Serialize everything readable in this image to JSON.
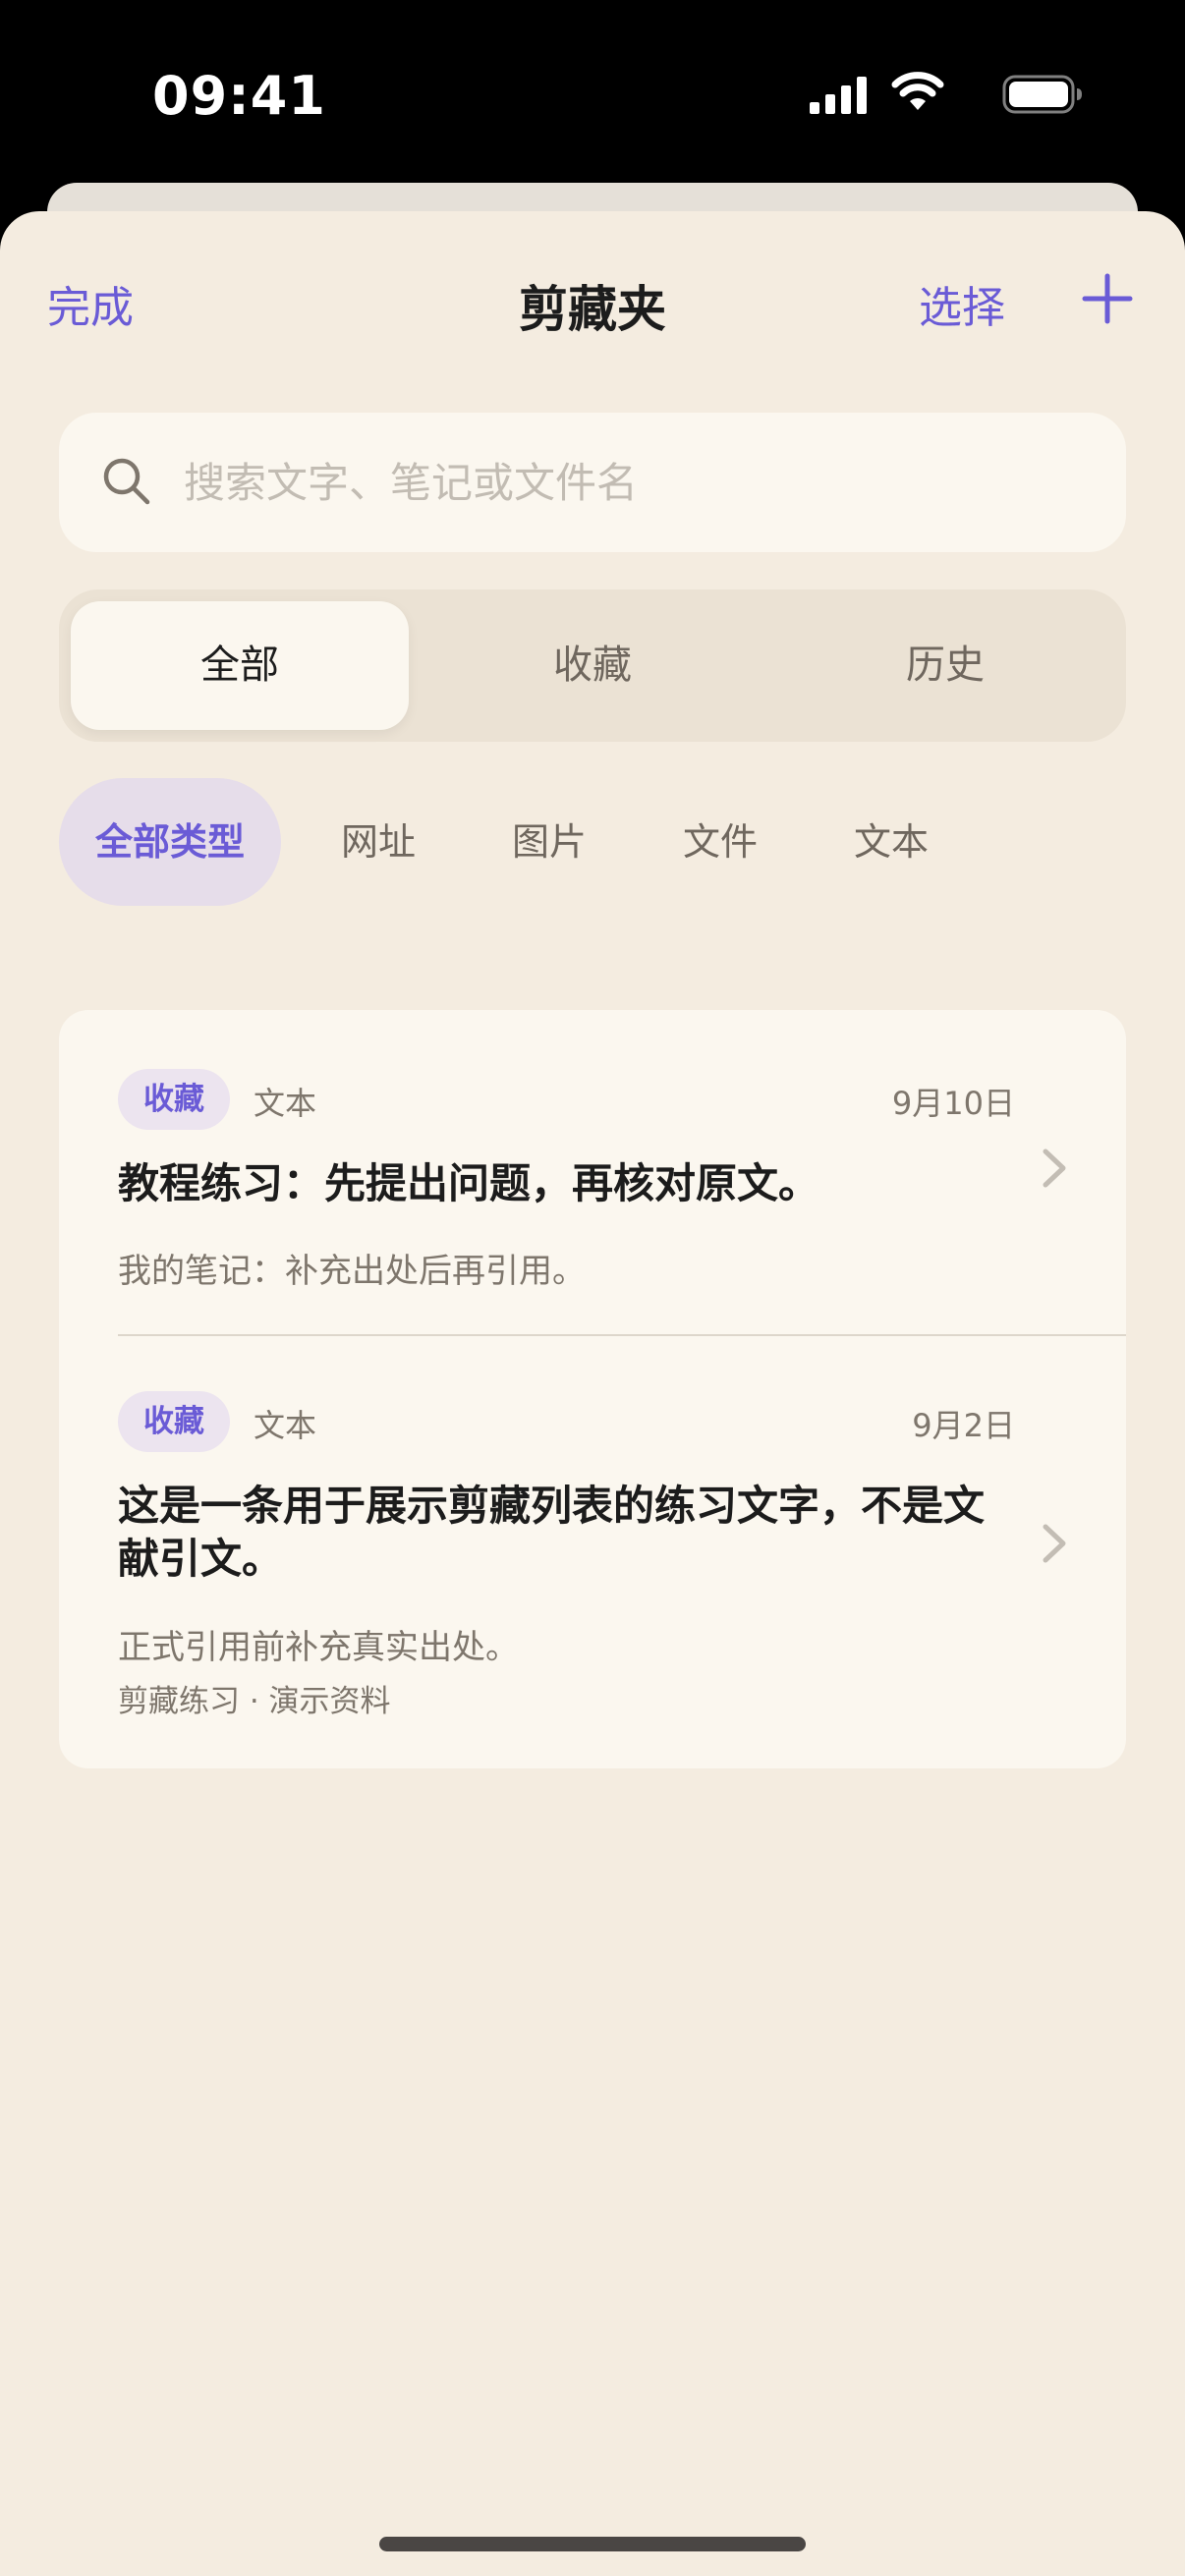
{
  "status_bar": {
    "time": "09:41"
  },
  "nav": {
    "done": "完成",
    "title": "剪藏夹",
    "select": "选择"
  },
  "search": {
    "placeholder": "搜索文字、笔记或文件名",
    "value": ""
  },
  "segments": [
    {
      "label": "全部",
      "selected": true
    },
    {
      "label": "收藏",
      "selected": false
    },
    {
      "label": "历史",
      "selected": false
    }
  ],
  "filters": [
    {
      "label": "全部类型",
      "selected": true
    },
    {
      "label": "网址",
      "selected": false
    },
    {
      "label": "图片",
      "selected": false
    },
    {
      "label": "文件",
      "selected": false
    },
    {
      "label": "文本",
      "selected": false
    }
  ],
  "items": [
    {
      "badge": "收藏",
      "type": "文本",
      "date": "9月10日",
      "title": "教程练习：先提出问题，再核对原文。",
      "note": "我的笔记：补充出处后再引用。"
    },
    {
      "badge": "收藏",
      "type": "文本",
      "date": "9月2日",
      "title": "这是一条用于展示剪藏列表的练习文字，不是文献引文。",
      "note": "正式引用前补充真实出处。",
      "meta": "剪藏练习 · 演示资料"
    }
  ],
  "colors": {
    "accent": "#6a5bd6",
    "background": "#f4ece0",
    "card": "#fbf7ef"
  }
}
